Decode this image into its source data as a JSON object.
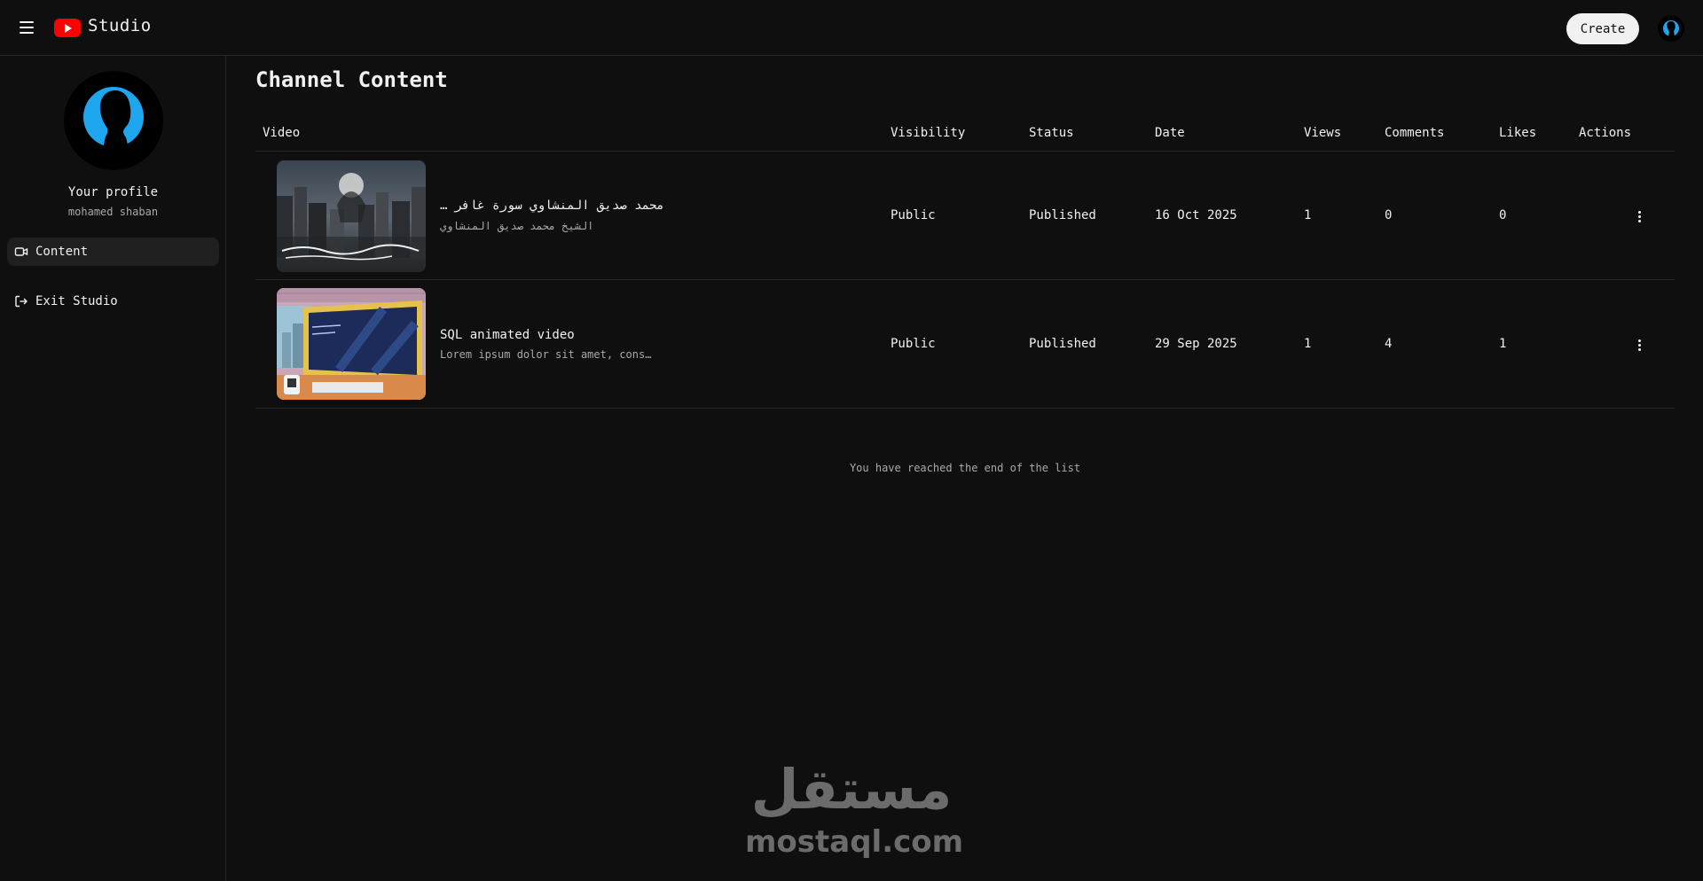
{
  "header": {
    "brand": "Studio",
    "create_label": "Create",
    "brand_color": "#ff0000"
  },
  "sidebar": {
    "profile_title": "Your profile",
    "profile_name": "mohamed shaban",
    "items": [
      {
        "label": "Content",
        "icon": "video-camera-icon",
        "active": true
      },
      {
        "label": "Exit Studio",
        "icon": "exit-icon",
        "active": false
      }
    ]
  },
  "main": {
    "title": "Channel Content",
    "columns": [
      "Video",
      "Visibility",
      "Status",
      "Date",
      "Views",
      "Comments",
      "Likes",
      "Actions"
    ],
    "rows": [
      {
        "title": "… محمد صديق المنشاوي سورة غافر",
        "description": "الشيخ محمد صديق المنشاوي",
        "visibility": "Public",
        "status": "Published",
        "date": "16 Oct 2025",
        "views": "1",
        "comments": "0",
        "likes": "0"
      },
      {
        "title": "SQL animated video",
        "description": "Lorem ipsum dolor sit amet, cons…",
        "visibility": "Public",
        "status": "Published",
        "date": "29 Sep 2025",
        "views": "1",
        "comments": "4",
        "likes": "1"
      }
    ],
    "end_message": "You have reached the end of the list"
  },
  "watermark": {
    "arabic": "مستقل",
    "latin": "mostaql.com"
  },
  "colors": {
    "background": "#0f0f0f",
    "avatar_accent": "#1ea7ef",
    "muted_text": "#aaaaaa"
  }
}
